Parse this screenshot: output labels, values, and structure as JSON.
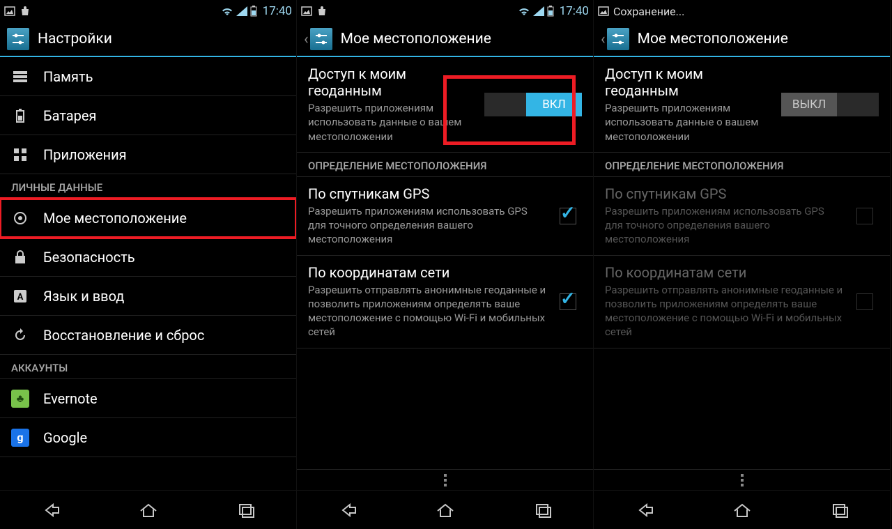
{
  "status": {
    "time": "17:40",
    "saving": "Сохранение..."
  },
  "panel1": {
    "title": "Настройки",
    "items": {
      "memory": "Память",
      "battery": "Батарея",
      "apps": "Приложения",
      "location": "Мое местоположение",
      "security": "Безопасность",
      "language": "Язык и ввод",
      "backup": "Восстановление и сброс",
      "evernote": "Evernote",
      "google": "Google"
    },
    "sections": {
      "personal": "ЛИЧНЫЕ ДАННЫЕ",
      "accounts": "АККАУНТЫ"
    }
  },
  "panel2": {
    "title": "Мое местоположение",
    "access_title": "Доступ к моим геоданным",
    "access_summary": "Разрешить приложениям использовать данные о вашем местоположении",
    "toggle_on": "ВКЛ",
    "section_sources": "ОПРЕДЕЛЕНИЕ МЕСТОПОЛОЖЕНИЯ",
    "gps_title": "По спутникам GPS",
    "gps_summary": "Разрешить приложениям использовать GPS для точного определения вашего местоположения",
    "net_title": "По координатам сети",
    "net_summary": "Разрешить отправлять анонимные геоданные и позволить приложениям определять ваше местоположение с помощью Wi-Fi и мобильных сетей"
  },
  "panel3": {
    "title": "Мое местоположение",
    "access_title": "Доступ к моим геоданным",
    "access_summary": "Разрешить приложениям использовать данные о вашем местоположении",
    "toggle_off": "ВЫКЛ",
    "section_sources": "ОПРЕДЕЛЕНИЕ МЕСТОПОЛОЖЕНИЯ",
    "gps_title": "По спутникам GPS",
    "gps_summary": "Разрешить приложениям использовать GPS для точного определения вашего местоположения",
    "net_title": "По координатам сети",
    "net_summary": "Разрешить отправлять анонимные геоданные и позволить приложениям определять ваше местоположение с помощью Wi-Fi и мобильных сетей"
  }
}
